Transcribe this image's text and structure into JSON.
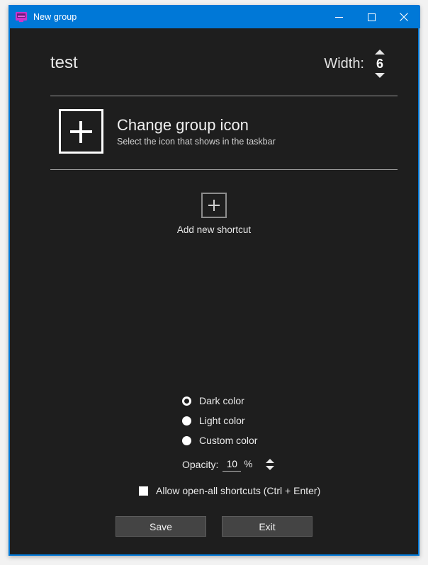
{
  "window": {
    "title": "New group",
    "app_icon": "monitor-icon",
    "accent_color": "#0078d7",
    "background_color": "#1e1e1e",
    "controls": {
      "minimize": "minimize-icon",
      "maximize": "maximize-icon",
      "close": "close-icon"
    }
  },
  "header": {
    "group_name": "test",
    "group_name_placeholder": "Group name",
    "width_label": "Width:",
    "width_value": "6",
    "width_up": "spinner-up-icon",
    "width_down": "spinner-down-icon"
  },
  "change_icon": {
    "plus": "plus-icon",
    "title": "Change group icon",
    "subtitle": "Select the icon that shows in the taskbar"
  },
  "shortcuts": {
    "add_plus": "plus-icon",
    "add_label": "Add new shortcut"
  },
  "options": {
    "color_modes": [
      {
        "label": "Dark color",
        "selected": true
      },
      {
        "label": "Light color",
        "selected": false
      },
      {
        "label": "Custom color",
        "selected": false
      }
    ],
    "opacity_label": "Opacity:",
    "opacity_value": "10",
    "opacity_unit": "%",
    "opacity_up": "spinner-up-icon",
    "opacity_down": "spinner-down-icon",
    "allow_open_all_label": "Allow open-all shortcuts (Ctrl + Enter)",
    "allow_open_all_checked": false
  },
  "footer": {
    "save_label": "Save",
    "exit_label": "Exit"
  }
}
